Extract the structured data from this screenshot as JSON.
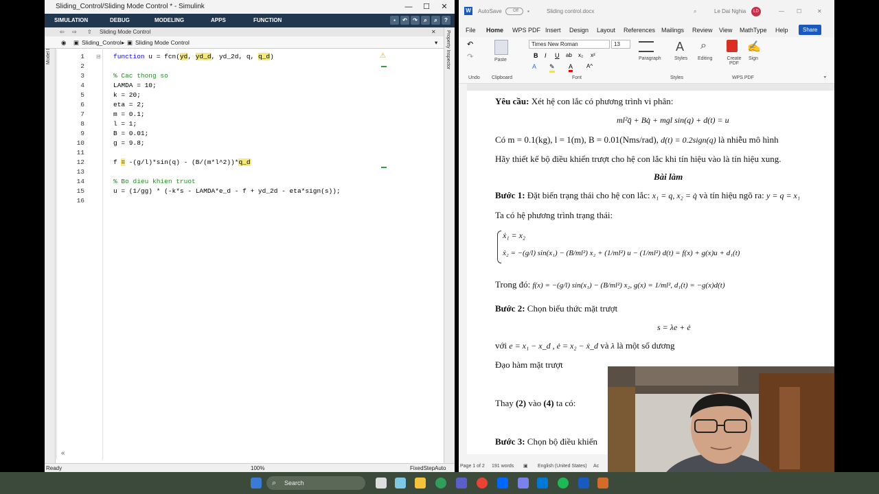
{
  "simulink": {
    "title": "Sliding_Control/Sliding Mode Control * - Simulink",
    "tabs": [
      "SIMULATION",
      "DEBUG",
      "MODELING",
      "APPS",
      "FUNCTION"
    ],
    "nav_path": "Sliding Mode Control",
    "breadcrumb": [
      "Sliding_Control",
      "Sliding Mode Control"
    ],
    "left_panel": "Model Browser",
    "right_panel": "Property Inspector",
    "code_lines": [
      {
        "n": "1",
        "text": "function u = fcn(yd, yd_d, yd_2d, q, q_d)"
      },
      {
        "n": "2",
        "text": ""
      },
      {
        "n": "3",
        "text": "% Cac thong so"
      },
      {
        "n": "4",
        "text": "LAMDA = 10;"
      },
      {
        "n": "5",
        "text": "k = 20;"
      },
      {
        "n": "6",
        "text": "eta = 2;"
      },
      {
        "n": "7",
        "text": "m = 0.1;"
      },
      {
        "n": "8",
        "text": "l = 1;"
      },
      {
        "n": "9",
        "text": "B = 0.01;"
      },
      {
        "n": "10",
        "text": "g = 9.8;"
      },
      {
        "n": "11",
        "text": ""
      },
      {
        "n": "12",
        "text": "f = -(g/l)*sin(q) - (B/(m*l^2))*q_d"
      },
      {
        "n": "13",
        "text": ""
      },
      {
        "n": "14",
        "text": "% Bo dieu khien truot"
      },
      {
        "n": "15",
        "text": "u = (1/gg) * (-k*s - LAMDA*e_d - f + yd_2d - eta*sign(s));"
      },
      {
        "n": "16",
        "text": ""
      }
    ],
    "status_left": "Ready",
    "status_zoom": "100%",
    "status_solver": "FixedStepAuto"
  },
  "word": {
    "autosave": "AutoSave",
    "autosave_state": "Off",
    "doc_title": "Sliding control.docx",
    "user": "Le Dai Nghia",
    "user_initials": "LD",
    "menu": [
      "File",
      "Home",
      "WPS PDF",
      "Insert",
      "Design",
      "Layout",
      "References",
      "Mailings",
      "Review",
      "View",
      "MathType",
      "Help"
    ],
    "share": "Share",
    "font_name": "Times New Roman",
    "font_size": "13",
    "groups": [
      "Undo",
      "Clipboard",
      "Font",
      "Styles",
      "Editing",
      "WPS PDF"
    ],
    "paste": "Paste",
    "paragraph": "Paragraph",
    "styles": "Styles",
    "editing": "Editing",
    "create_pdf": "Create PDF",
    "sign": "Sign",
    "doc": {
      "yeu_cau_b": "Yêu cầu:",
      "yeu_cau": " Xét hệ con lắc có phương trình vi phân:",
      "eq1": "ml²q̈ + Bq̇ + mgl sin(q) + d(t) = u",
      "co": "Có m = 0.1(kg), l = 1(m), B = 0.01(Nms/rad),",
      "co_eq": "d(t) = 0.2sign(q)",
      "co_end": "là nhiễu mô hình",
      "hay": "Hãy thiết kế bộ điều khiển trượt cho hệ con lắc khi tín hiệu vào là tín hiệu xung.",
      "bai_lam": "Bài làm",
      "buoc1_b": "Bước 1:",
      "buoc1": " Đặt biến trạng thái cho hệ con lắc:",
      "buoc1_eq": "x₁ = q, x₂ = q̇",
      "buoc1_mid": "và tín hiệu ngõ ra:",
      "buoc1_eq2": "y = q = x₁",
      "ta_co": "Ta có hệ phương trình trạng thái:",
      "sys1": "ẋ₁ = x₂",
      "sys2": "ẋ₂ = −(g/l) sin(x₁) − (B/ml²) x₂ + (1/ml²) u − (1/ml²) d(t) = f(x) + g(x)u + d₁(t)",
      "trong_do": "Trong đó:",
      "trong_do_eq": "f(x) = −(g/l) sin(x₁) − (B/ml²) x₂,  g(x) = 1/ml², d₁(t) = −g(x)d(t)",
      "buoc2_b": "Bước 2:",
      "buoc2": " Chọn biểu thức mặt trượt",
      "s_eq": "s = λe + ė",
      "voi": "với",
      "voi_eq": "e = x₁ − x_d , ė = x₂ − ẋ_d",
      "voi_va": "và",
      "lambda": "λ",
      "voi_end": "là một số dương",
      "dao_ham": "Đạo hàm mặt trượt",
      "thay_a": "Thay ",
      "thay_2": "(2)",
      "thay_b": " vào ",
      "thay_4": "(4)",
      "thay_c": " ta có:",
      "buoc3_b": "Bước 3:",
      "buoc3": " Chọn bộ điều khiển"
    },
    "status_page": "Page 1 of 2",
    "status_words": "191 words",
    "status_lang": "English (United States)",
    "status_acc": "Ac"
  },
  "taskbar": {
    "search": "Search"
  },
  "colors": {
    "simulink_ribbon": "#21374f",
    "word_accent": "#185abd",
    "taskbar": "#3b4a3a"
  }
}
